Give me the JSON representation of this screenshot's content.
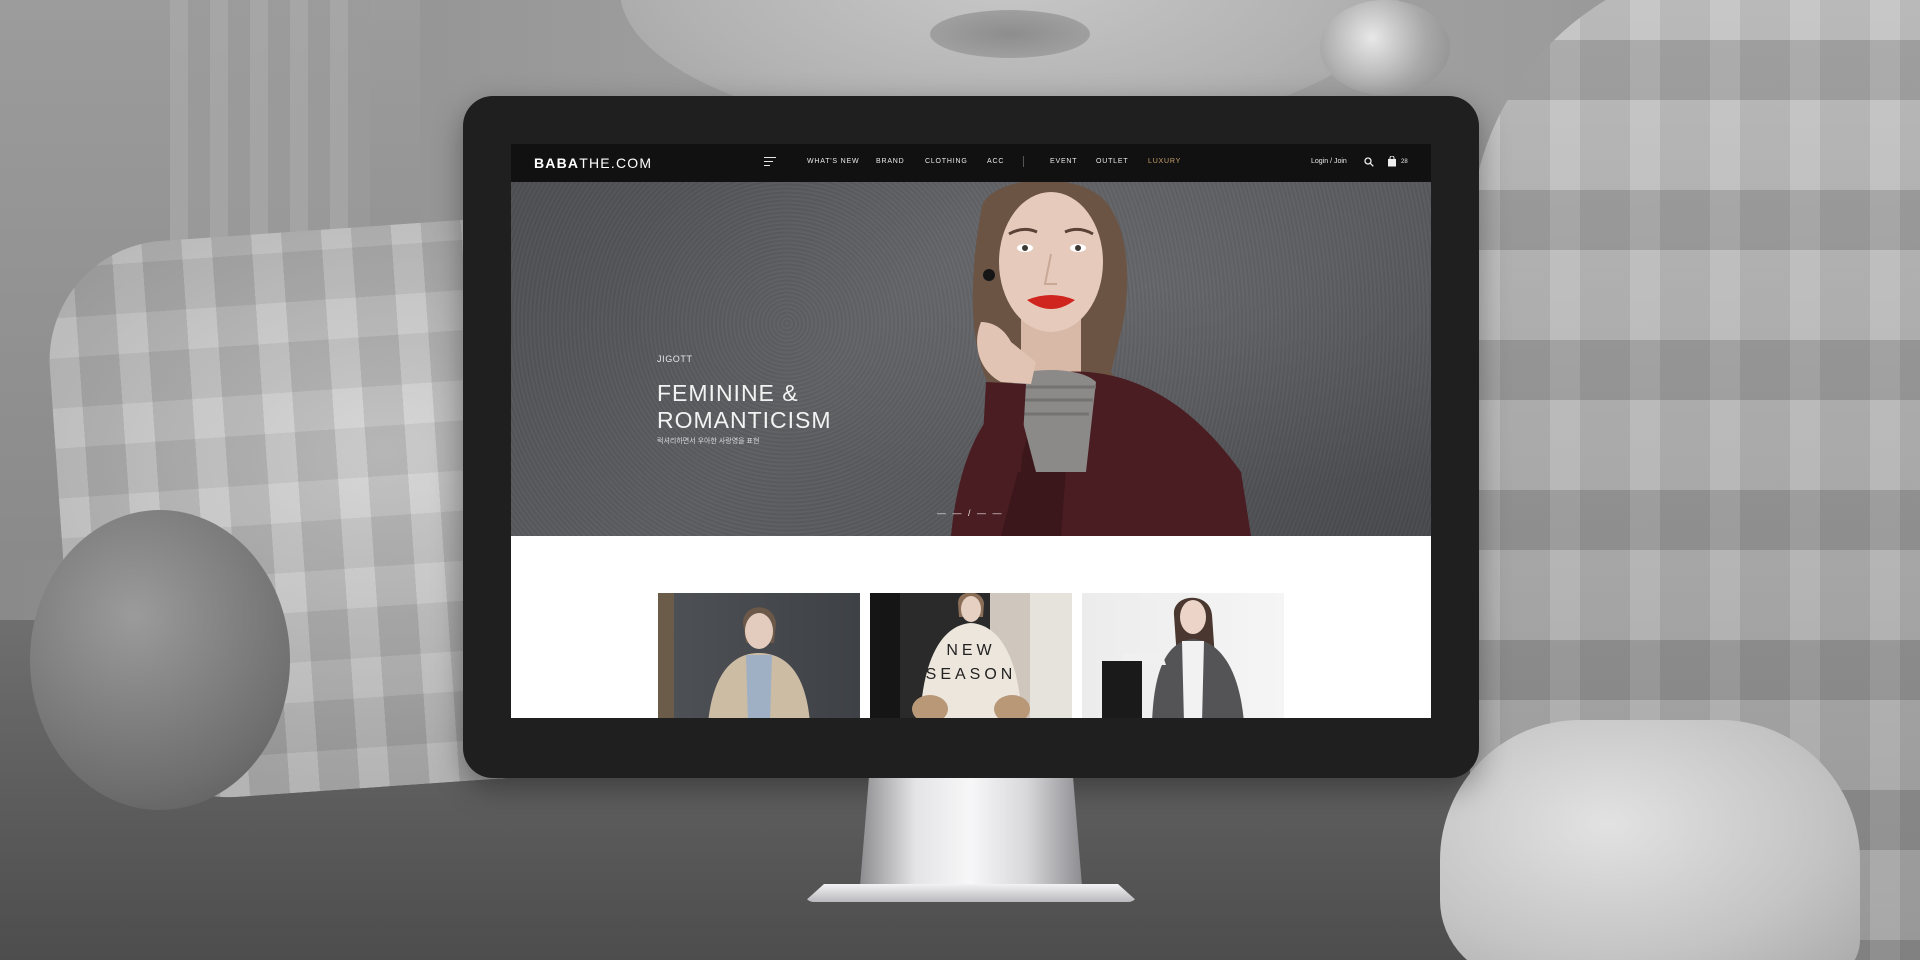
{
  "site": {
    "logo_bold": "BABA",
    "logo_rest": "THE.COM"
  },
  "nav": {
    "items": [
      "WHAT'S NEW",
      "BRAND",
      "CLOTHING",
      "ACC",
      "EVENT",
      "OUTLET",
      "LUXURY"
    ],
    "login": "Login / Join",
    "cart_count": "28"
  },
  "hero": {
    "brand": "JIGOTT",
    "title_line1": "FEMININE &",
    "title_line2": "ROMANTICISM",
    "subtitle": "럭셔리하면서 우아한 사랑영을 표현",
    "pager": "— — / — —"
  },
  "featured": {
    "thumb2_line1": "NEW",
    "thumb2_line2": "SEASON"
  },
  "colors": {
    "accent_luxury": "#c7a16b",
    "lip_red": "#d0251f",
    "coat_burgundy": "#4a1d22"
  }
}
